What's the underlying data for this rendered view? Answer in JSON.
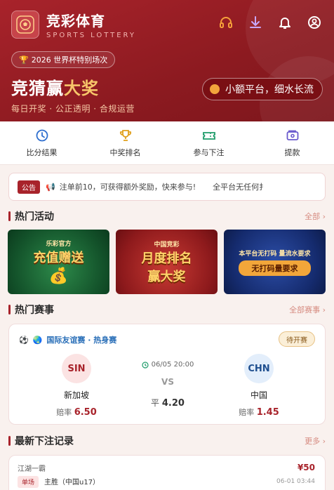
{
  "header": {
    "brand_title": "竞彩体育",
    "brand_subtitle": "SPORTS LOTTERY",
    "promo_pill": "2026 世界杯特别场次",
    "headline_main": "竞猜赢",
    "headline_highlight": "大奖",
    "tagline": "每日开奖 · 公正透明 · 合规运营",
    "slogan": "小额平台，细水长流"
  },
  "nav_tabs": [
    {
      "label": "比分结果",
      "icon": "clock-icon"
    },
    {
      "label": "中奖排名",
      "icon": "trophy-icon"
    },
    {
      "label": "参与下注",
      "icon": "ticket-icon"
    },
    {
      "label": "提款",
      "icon": "wallet-icon"
    }
  ],
  "notice": {
    "badge": "公告",
    "text": "注单前10，可获得额外奖励，快来参与!",
    "text2": "全平台无任何扌"
  },
  "activities": {
    "title": "热门活动",
    "more": "全部 ›",
    "banners": [
      {
        "title": "充值赠送",
        "top": "乐彩官方"
      },
      {
        "title": "月度排名",
        "title2": "赢大奖",
        "top": "中国竞彩"
      },
      {
        "title": "无打码量要求",
        "top": "本平台无打码 量流水要求"
      }
    ]
  },
  "matches": {
    "title": "热门赛事",
    "more": "全部赛事 ›",
    "card": {
      "league": "国际友谊赛 · 热身赛",
      "status": "待开赛",
      "time": "06/05 20:00",
      "vs": "VS",
      "draw_label": "平",
      "draw_odds": "4.20",
      "home": {
        "code": "SIN",
        "name": "新加坡",
        "odds_label": "赔率",
        "odds": "6.50"
      },
      "away": {
        "code": "CHN",
        "name": "中国",
        "odds_label": "赔率",
        "odds": "1.45"
      }
    }
  },
  "records": {
    "title": "最新下注记录",
    "more": "更多 ›",
    "item": {
      "user": "江湖一霸",
      "amount": "¥50",
      "type": "单场",
      "pick": "主胜（中国u17）",
      "time": "06-01 03:44"
    }
  },
  "colors": {
    "brand_red": "#a8232b",
    "gold": "#f7c66a",
    "link": "#d68b80"
  }
}
